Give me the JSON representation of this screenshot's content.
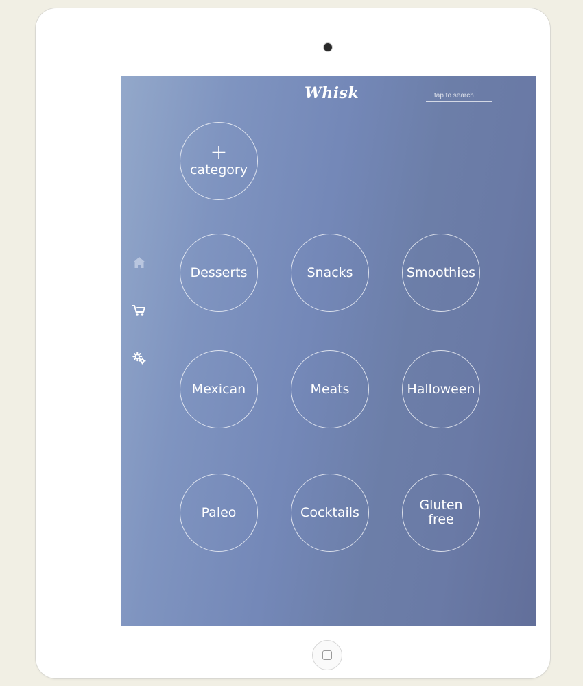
{
  "header": {
    "logo": "Whisk",
    "search_placeholder": "tap to search"
  },
  "sidebar": {
    "items": [
      {
        "icon": "home-icon"
      },
      {
        "icon": "cart-icon"
      },
      {
        "icon": "gear-icon"
      }
    ]
  },
  "add_category": {
    "plus": "+",
    "label": "category"
  },
  "categories": [
    {
      "label": "Desserts"
    },
    {
      "label": "Snacks"
    },
    {
      "label": "Smoothies"
    },
    {
      "label": "Mexican"
    },
    {
      "label": "Meats"
    },
    {
      "label": "Halloween"
    },
    {
      "label": "Paleo"
    },
    {
      "label": "Cocktails"
    },
    {
      "label": "Gluten free"
    }
  ],
  "colors": {
    "page_background": "#f1efe4",
    "device_frame": "#ffffff",
    "screen_gradient_start": "#93a8ca",
    "screen_gradient_end": "#626f9a",
    "text": "#ffffff"
  }
}
